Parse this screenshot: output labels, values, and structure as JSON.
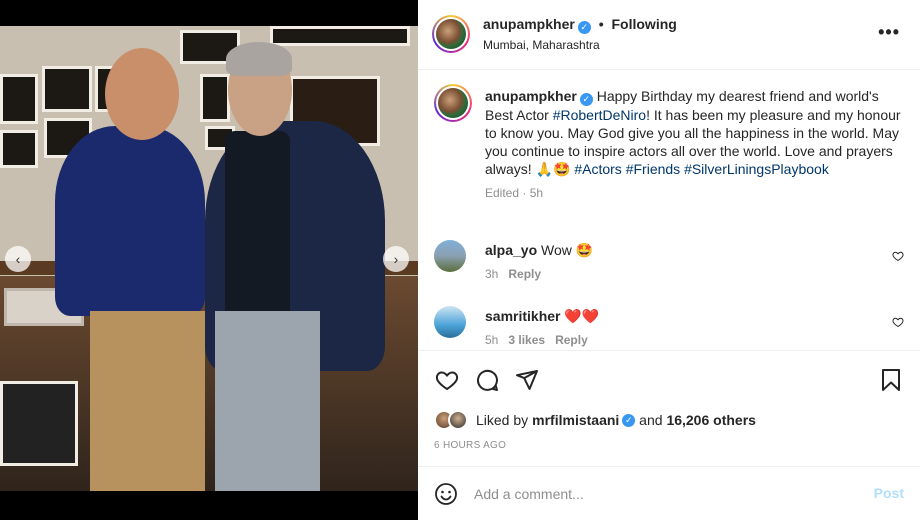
{
  "post": {
    "username": "anupampkher",
    "follow_status": "Following",
    "location": "Mumbai, Maharashtra",
    "more_icon": "more-options-icon"
  },
  "caption": {
    "username": "anupampkher",
    "text_1": "Happy Birthday my dearest friend and world's Best Actor ",
    "tag_1": "#RobertDeNiro",
    "text_2": "! It has been my pleasure and my honour to know you. May God give you all the happiness in the world. May you continue to inspire actors all over the world. Love and prayers always! ",
    "emoji": "🙏🤩",
    "tag_2": "#Actors",
    "tag_3": "#Friends",
    "tag_4": "#SilverLiningsPlaybook",
    "meta": "Edited · 5h"
  },
  "comments": [
    {
      "username": "alpa_yo",
      "text": "Wow 🤩",
      "time": "3h",
      "likes": "",
      "reply": "Reply"
    },
    {
      "username": "samritikher",
      "text": "❤️❤️",
      "time": "5h",
      "likes": "3 likes",
      "reply": "Reply"
    }
  ],
  "likes": {
    "prefix": "Liked by ",
    "user": "mrfilmistaani",
    "middle": " and ",
    "count": "16,206 others"
  },
  "timestamp": "6 HOURS AGO",
  "add_comment": {
    "placeholder": "Add a comment...",
    "post_label": "Post"
  },
  "colors": {
    "verified": "#3897f0",
    "hashtag": "#00376b",
    "post_disabled": "#b2dffc"
  },
  "icons": [
    "heart-icon",
    "comment-icon",
    "share-icon",
    "bookmark-icon",
    "emoji-icon",
    "chevron-left-icon",
    "chevron-right-icon"
  ]
}
